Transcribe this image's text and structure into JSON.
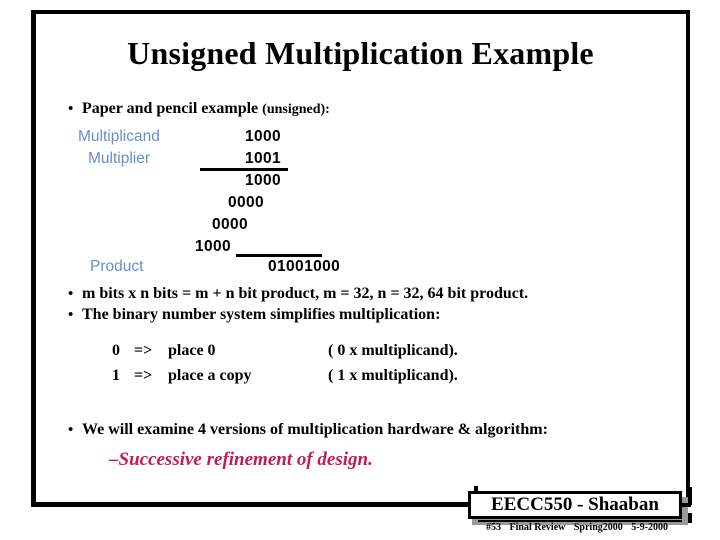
{
  "slide": {
    "title": "Unsigned Multiplication Example",
    "accent_label_color": "#6a8ccc",
    "accent_crimson_color": "#c41b52",
    "frame_color": "#000000"
  },
  "bullets": {
    "paper_pencil_main": "Paper and pencil example ",
    "paper_pencil_small": "(unsigned):",
    "m_bits": "m bits  x n  bits =   m + n  bit product,   m = 32, n = 32,  64 bit product.",
    "binary_system": "The binary number system simplifies multiplication:",
    "versions": "We will examine 4 versions of multiplication hardware & algorithm:",
    "marker": "•"
  },
  "multiplication": {
    "labels": {
      "multiplicand": "Multiplicand",
      "multiplier": "Multiplier",
      "product": "Product"
    },
    "multiplicand_value": "1000",
    "multiplier_value": "1001",
    "partial_products": [
      "1000",
      "0000",
      "0000",
      "1000"
    ],
    "product_value": "01001000"
  },
  "rules": [
    {
      "bit": "0",
      "arrow": "=>",
      "action": "place 0",
      "note": "( 0 x multiplicand)."
    },
    {
      "bit": "1",
      "arrow": "=>",
      "action": "place a copy",
      "note": "( 1 x multiplicand)."
    }
  ],
  "sub_bullet": {
    "refinement": "–Successive refinement of design."
  },
  "footer": {
    "badge_title": "EECC550 - Shaaban",
    "slide_number": "#53",
    "course_part": "Final Review",
    "term": "Spring2000",
    "date": "5-9-2000"
  }
}
